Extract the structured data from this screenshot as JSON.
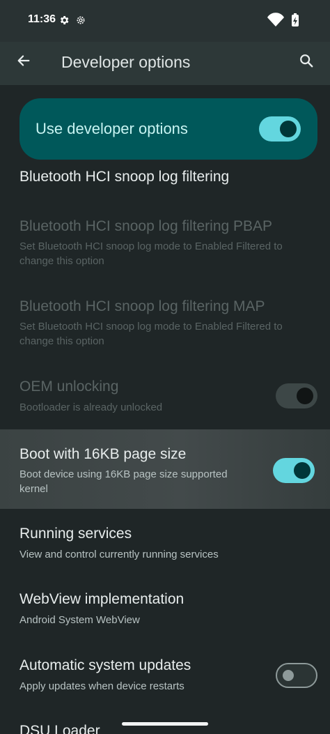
{
  "status_bar": {
    "time": "11:36",
    "left_icons": [
      "settings-gear-icon",
      "settings-gear-outline-icon"
    ],
    "right_icons": [
      "wifi-icon",
      "battery-charging-icon"
    ]
  },
  "app_bar": {
    "back_icon": "arrow-back-icon",
    "title": "Developer options",
    "search_icon": "search-icon"
  },
  "master_toggle": {
    "label": "Use developer options",
    "state": "on"
  },
  "preferences": [
    {
      "title": "Bluetooth HCI snoop log filtering",
      "summary": "",
      "enabled": true
    },
    {
      "title": "Bluetooth HCI snoop log filtering PBAP",
      "summary": "Set Bluetooth HCI snoop log mode to Enabled Filtered to change this option",
      "enabled": false
    },
    {
      "title": "Bluetooth HCI snoop log filtering MAP",
      "summary": "Set Bluetooth HCI snoop log mode to Enabled Filtered to change this option",
      "enabled": false
    },
    {
      "title": "OEM unlocking",
      "summary": "Bootloader is already unlocked",
      "enabled": false,
      "switch": "on"
    },
    {
      "title": "Boot with 16KB page size",
      "summary": "Boot device using 16KB page size supported kernel",
      "enabled": true,
      "switch": "on",
      "highlighted": true
    },
    {
      "title": "Running services",
      "summary": "View and control currently running services",
      "enabled": true
    },
    {
      "title": "WebView implementation",
      "summary": "Android System WebView",
      "enabled": true
    },
    {
      "title": "Automatic system updates",
      "summary": "Apply updates when device restarts",
      "enabled": true,
      "switch": "off"
    },
    {
      "title": "DSU Loader",
      "summary": "",
      "enabled": true
    }
  ],
  "colors": {
    "background": "#1f2627",
    "app_bar": "#2d3838",
    "master_card": "#00585a",
    "switch_on_track": "#63d6df",
    "switch_on_thumb": "#003739"
  }
}
